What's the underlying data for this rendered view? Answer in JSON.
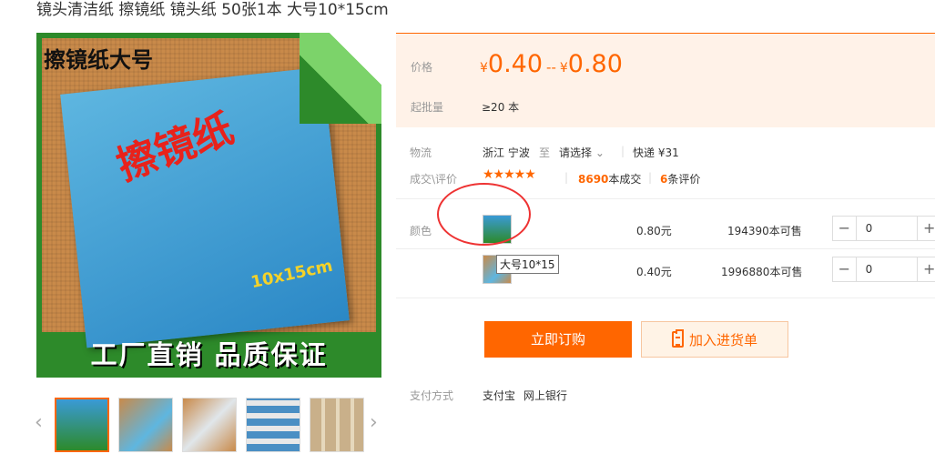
{
  "page_title": "镜头清洁纸 擦镜纸 镜头纸 50张1本 大号10*15cm",
  "main_image": {
    "overlay_top": "擦镜纸大号",
    "book_title": "擦镜纸",
    "book_size": "10x15cm",
    "overlay_bottom": "工厂直销  品质保证"
  },
  "thumbnails": {
    "prev_icon": "chevron-left-icon",
    "next_icon": "chevron-right-icon",
    "count": 5,
    "active_index": 0
  },
  "price": {
    "label": "价格",
    "currency": "¥",
    "min": "0.40",
    "sep": "--",
    "max": "0.80"
  },
  "moq": {
    "label": "起批量",
    "value": "≥20 本"
  },
  "logistics": {
    "label": "物流",
    "origin": "浙江 宁波",
    "to": "至",
    "dest": "请选择",
    "shipping": "快递 ¥31"
  },
  "reviews": {
    "label": "成交\\评价",
    "stars": "★★★★★",
    "deals_count": "8690",
    "deals_suffix": "本成交",
    "reviews_count": "6",
    "reviews_suffix": "条评价"
  },
  "sku": {
    "label": "颜色",
    "tooltip": "大号10*15",
    "items": [
      {
        "price": "0.80元",
        "stock": "194390本可售",
        "qty": "0"
      },
      {
        "price": "0.40元",
        "stock": "1996880本可售",
        "qty": "0"
      }
    ],
    "minus": "−",
    "plus": "+"
  },
  "actions": {
    "buy": "立即订购",
    "cart": "加入进货单"
  },
  "payment": {
    "label": "支付方式",
    "alipay": "支付宝",
    "bank": "网上银行"
  },
  "colors": {
    "accent": "#ff6600",
    "annotation": "#e33333"
  }
}
